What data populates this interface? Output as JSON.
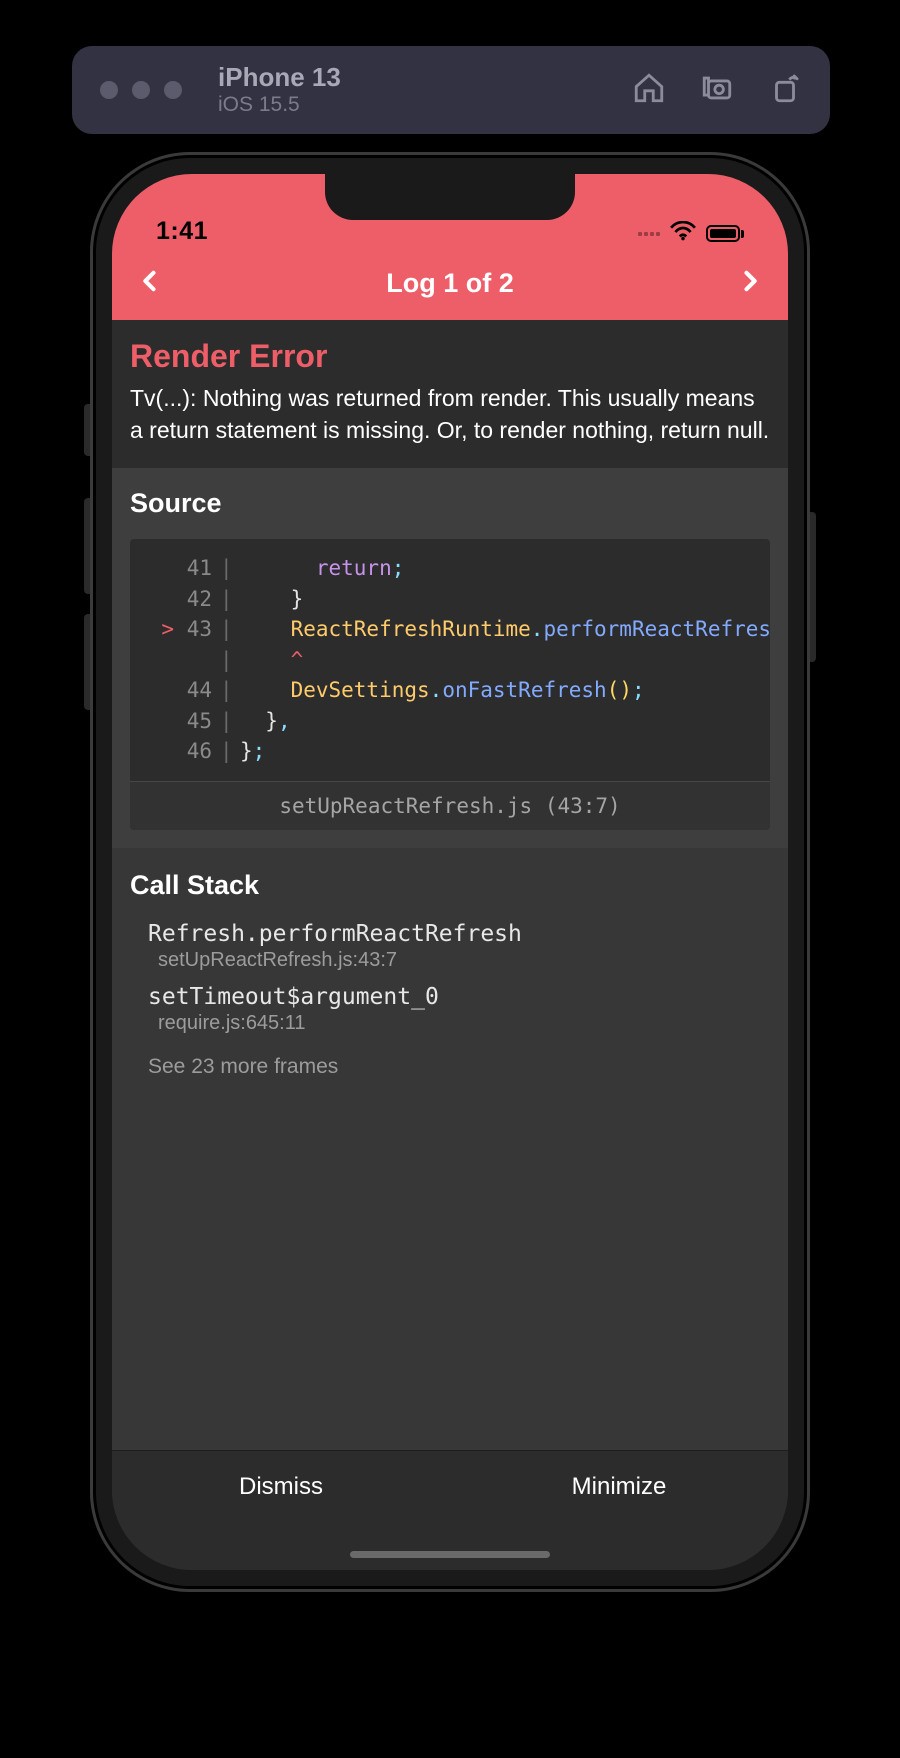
{
  "simulator": {
    "device": "iPhone 13",
    "os": "iOS 15.5"
  },
  "statusBar": {
    "time": "1:41"
  },
  "logNav": {
    "title": "Log 1 of 2"
  },
  "error": {
    "title": "Render Error",
    "message": "Tv(...): Nothing was returned from render. This usually means a return statement is missing. Or, to render nothing, return null."
  },
  "source": {
    "header": "Source",
    "footer": "setUpReactRefresh.js (43:7)",
    "lines": [
      {
        "gutter": "41",
        "mark": "",
        "indent": "      ",
        "tokens": [
          [
            "kw",
            "return"
          ],
          [
            "punc",
            ";"
          ]
        ]
      },
      {
        "gutter": "42",
        "mark": "",
        "indent": "    ",
        "tokens": [
          [
            "plain",
            "}"
          ]
        ]
      },
      {
        "gutter": "43",
        "mark": ">",
        "indent": "    ",
        "tokens": [
          [
            "id",
            "ReactRefreshRuntime"
          ],
          [
            "punc",
            "."
          ],
          [
            "fn",
            "performReactRefresh"
          ]
        ]
      },
      {
        "gutter": "",
        "mark": "",
        "indent": "    ",
        "tokens": [
          [
            "caret",
            "^"
          ]
        ]
      },
      {
        "gutter": "44",
        "mark": "",
        "indent": "    ",
        "tokens": [
          [
            "id",
            "DevSettings"
          ],
          [
            "punc",
            "."
          ],
          [
            "fn",
            "onFastRefresh"
          ],
          [
            "paren",
            "()"
          ],
          [
            "punc",
            ";"
          ]
        ]
      },
      {
        "gutter": "45",
        "mark": "",
        "indent": "  ",
        "tokens": [
          [
            "plain",
            "}"
          ],
          [
            "punc",
            ","
          ]
        ]
      },
      {
        "gutter": "46",
        "mark": "",
        "indent": "",
        "tokens": [
          [
            "plain",
            "}"
          ],
          [
            "punc",
            ";"
          ]
        ]
      }
    ]
  },
  "callStack": {
    "header": "Call Stack",
    "frames": [
      {
        "fn": "Refresh.performReactRefresh",
        "loc": "setUpReactRefresh.js:43:7"
      },
      {
        "fn": "setTimeout$argument_0",
        "loc": "require.js:645:11"
      }
    ],
    "moreLabel": "See 23 more frames"
  },
  "actions": {
    "dismiss": "Dismiss",
    "minimize": "Minimize"
  }
}
